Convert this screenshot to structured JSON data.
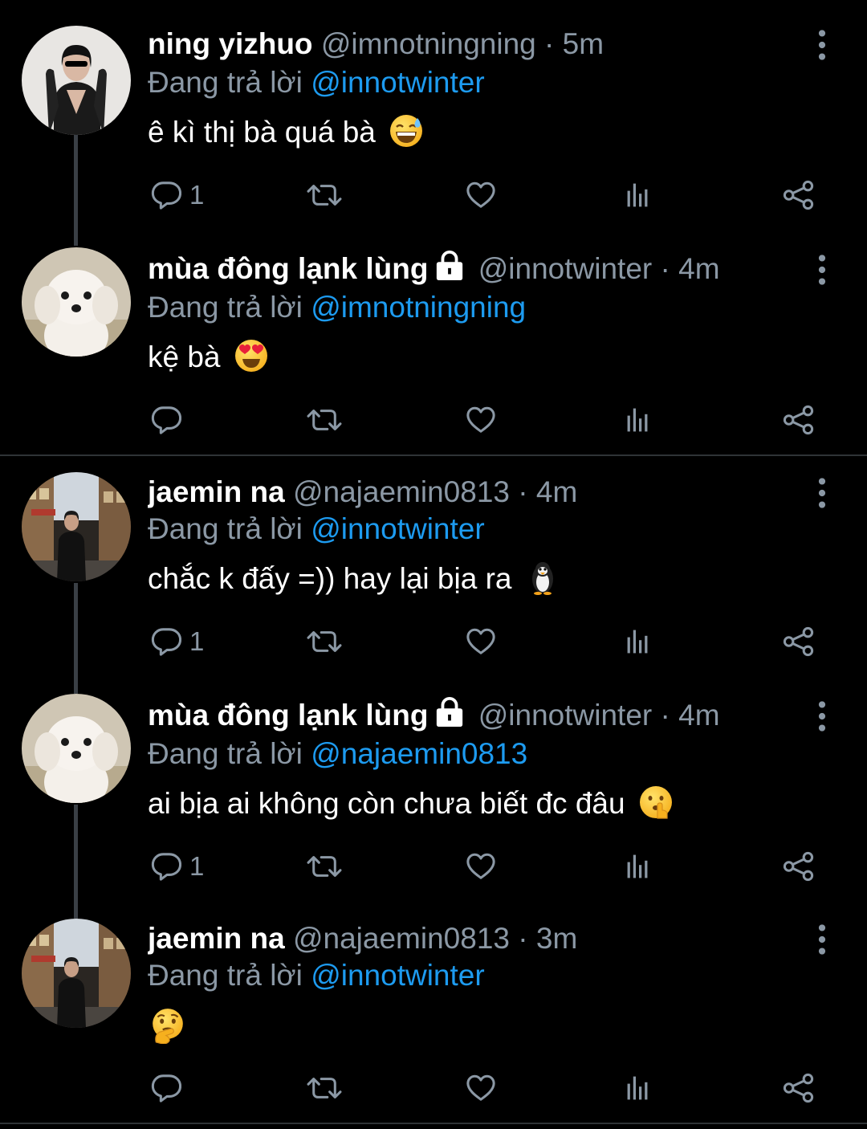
{
  "colors": {
    "background": "#000000",
    "name": "#ffffff",
    "muted": "#8b98a5",
    "mention": "#1d9bf0",
    "thread_line": "#3a3f45"
  },
  "tweets": [
    {
      "name": "ning yizhuo",
      "handle": "@imnotningning",
      "sep": "·",
      "time": "5m",
      "replying_prefix": "Đang trả lời ",
      "replying_to": "@innotwinter",
      "text": "ê kì thị bà quá bà",
      "emoji": "grinning-sweat-emoji",
      "reply_count": "1",
      "locked": false,
      "avatar": "girl-sunglasses-avatar"
    },
    {
      "name": "mùa đông lạnk lùng",
      "handle": "@innotwinter",
      "sep": "·",
      "time": "4m",
      "replying_prefix": "Đang trả lời ",
      "replying_to": "@imnotningning",
      "text": "kệ bà",
      "emoji": "heart-eyes-emoji",
      "reply_count": "",
      "locked": true,
      "avatar": "white-puppy-avatar"
    },
    {
      "name": "jaemin na",
      "handle": "@najaemin0813",
      "sep": "·",
      "time": "4m",
      "replying_prefix": "Đang trả lời ",
      "replying_to": "@innotwinter",
      "text": "chắc k đấy =)) hay lại bịa ra",
      "emoji": "penguin-emoji",
      "reply_count": "1",
      "locked": false,
      "avatar": "street-photo-avatar"
    },
    {
      "name": "mùa đông lạnk lùng",
      "handle": "@innotwinter",
      "sep": "·",
      "time": "4m",
      "replying_prefix": "Đang trả lời ",
      "replying_to": "@najaemin0813",
      "text": "ai bịa ai không còn chưa biết đc đâu",
      "emoji": "shushing-face-emoji",
      "reply_count": "1",
      "locked": true,
      "avatar": "white-puppy-avatar"
    },
    {
      "name": "jaemin na",
      "handle": "@najaemin0813",
      "sep": "·",
      "time": "3m",
      "replying_prefix": "Đang trả lời ",
      "replying_to": "@innotwinter",
      "text": "",
      "emoji": "thinking-face-emoji",
      "reply_count": "",
      "locked": false,
      "avatar": "street-photo-avatar"
    }
  ]
}
